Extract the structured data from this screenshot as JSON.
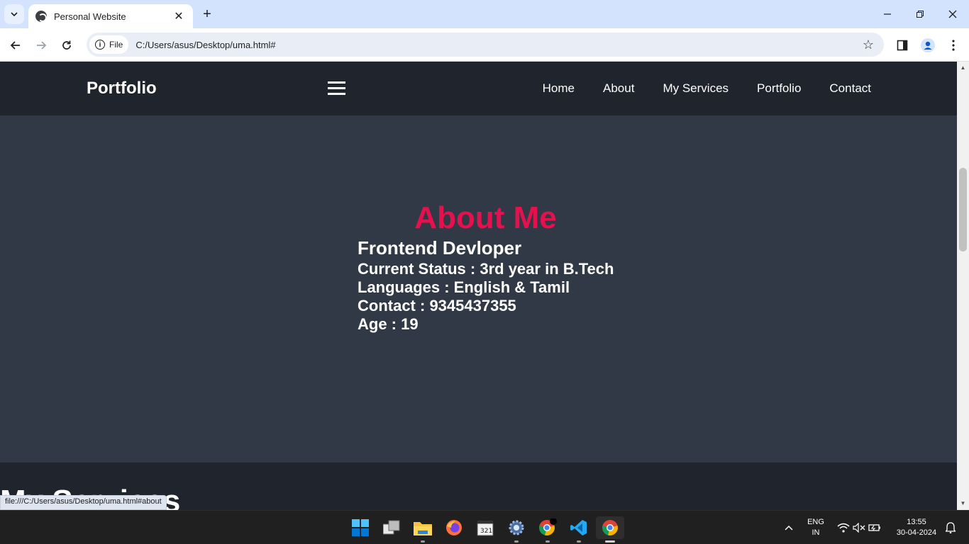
{
  "browser": {
    "tab_title": "Personal Website",
    "tab_close": "✕",
    "new_tab": "+",
    "chip_label": "File",
    "url": "C:/Users/asus/Desktop/uma.html#",
    "status_url": "file:///C:/Users/asus/Desktop/uma.html#about"
  },
  "site": {
    "logo": "Portfolio",
    "nav": [
      "Home",
      "About",
      "My Services",
      "Portfolio",
      "Contact"
    ]
  },
  "about": {
    "heading": "About Me",
    "role": "Frontend Devloper",
    "lines": [
      "Current Status : 3rd year in B.Tech",
      "Languages : English & Tamil",
      "Contact : 9345437355",
      "Age : 19"
    ]
  },
  "services": {
    "heading": "My Services"
  },
  "taskbar": {
    "lang_top": "ENG",
    "lang_bottom": "IN",
    "time": "13:55",
    "date": "30-04-2024"
  },
  "colors": {
    "accent": "#e5104e",
    "page_bg": "#323946",
    "header_bg": "#1f242d",
    "browser_tabstrip": "#d3e3fd"
  }
}
